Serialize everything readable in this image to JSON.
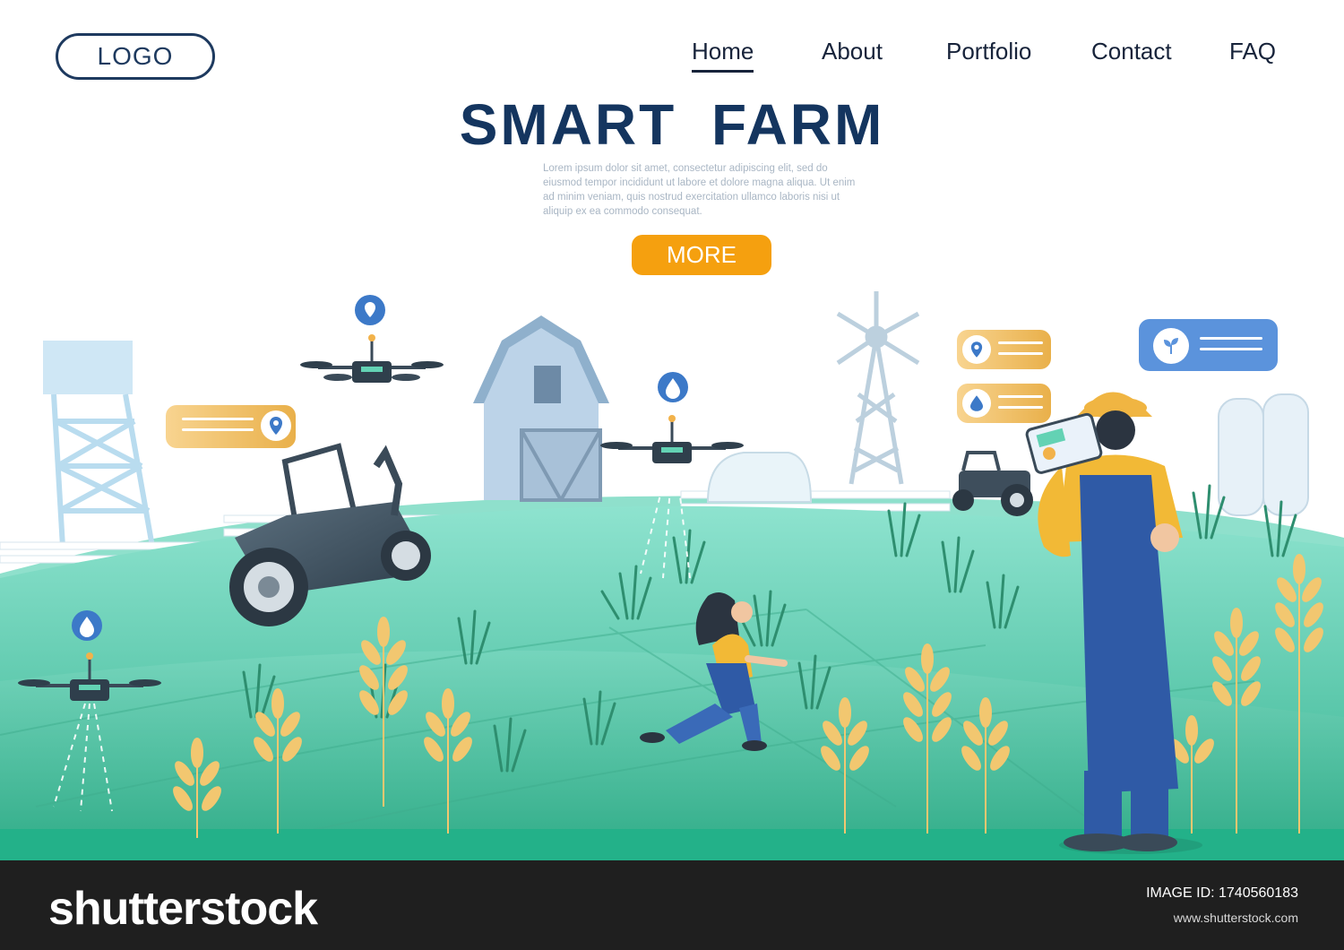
{
  "header": {
    "logo": "LOGO",
    "nav": [
      {
        "label": "Home",
        "active": true
      },
      {
        "label": "About",
        "active": false
      },
      {
        "label": "Portfolio",
        "active": false
      },
      {
        "label": "Contact",
        "active": false
      },
      {
        "label": "FAQ",
        "active": false
      }
    ]
  },
  "hero": {
    "title": "SMART FARM",
    "body": "Lorem ipsum dolor sit amet, consectetur adipiscing elit, sed do eiusmod tempor incididunt ut labore et dolore magna aliqua. Ut enim ad minim veniam, quis nostrud exercitation ullamco laboris nisi ut aliquip ex ea commodo consequat.",
    "button_label": "MORE"
  },
  "colors": {
    "accent": "#f5a00f",
    "title": "#14355f",
    "field": "#4fc3a3",
    "wheat": "#f2c770"
  },
  "footer": {
    "brand": "shutterstock",
    "image_id_label": "IMAGE ID: 1740560183",
    "url": "www.shutterstock.com"
  }
}
